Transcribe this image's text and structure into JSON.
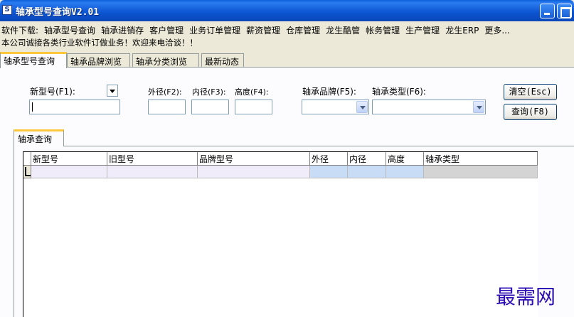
{
  "window": {
    "title": "轴承型号查询V2.01",
    "icon": "app-icon"
  },
  "menu": {
    "items": [
      "软件下载:",
      "轴承型号查询",
      "轴承进销存",
      "客户管理",
      "业务订单管理",
      "薪资管理",
      "仓库管理",
      "龙生酷管",
      "帐务管理",
      "生产管理",
      "龙生ERP",
      "更多..."
    ]
  },
  "notice": "本公司诚接各类行业软件订做业务！欢迎来电洽谈！！",
  "tabs": [
    {
      "label": "轴承型号查询",
      "active": true
    },
    {
      "label": "轴承品牌浏览",
      "active": false
    },
    {
      "label": "轴承分类浏览",
      "active": false
    },
    {
      "label": "最新动态",
      "active": false
    }
  ],
  "search": {
    "new_model_label": "新型号(F1):",
    "new_model_value": "",
    "outer_label": "外径(F2):",
    "inner_label": "内径(F3):",
    "height_label": "高度(F4):",
    "outer_value": "",
    "inner_value": "",
    "height_value": "",
    "brand_label": "轴承品牌(F5):",
    "brand_value": "",
    "type_label": "轴承类型(F6):",
    "type_value": "",
    "clear_button": "清空(Esc)",
    "query_button": "查询(F8)"
  },
  "results": {
    "tab_label": "轴承查询",
    "columns": [
      "新型号",
      "旧型号",
      "品牌型号",
      "外径",
      "内径",
      "高度",
      "轴承类型"
    ],
    "rows": [
      [
        "",
        "",
        "",
        "",
        "",
        "",
        ""
      ]
    ],
    "colors": {
      "row_default": "#F0ECFA",
      "row_dims": "#C8DDF5",
      "row_type": "#D4D4D4"
    }
  },
  "watermark": "最需网",
  "colors": {
    "title_bar": "#0A54D0",
    "tab_highlight": "#FFC73C",
    "watermark": "#2E0FB5"
  }
}
